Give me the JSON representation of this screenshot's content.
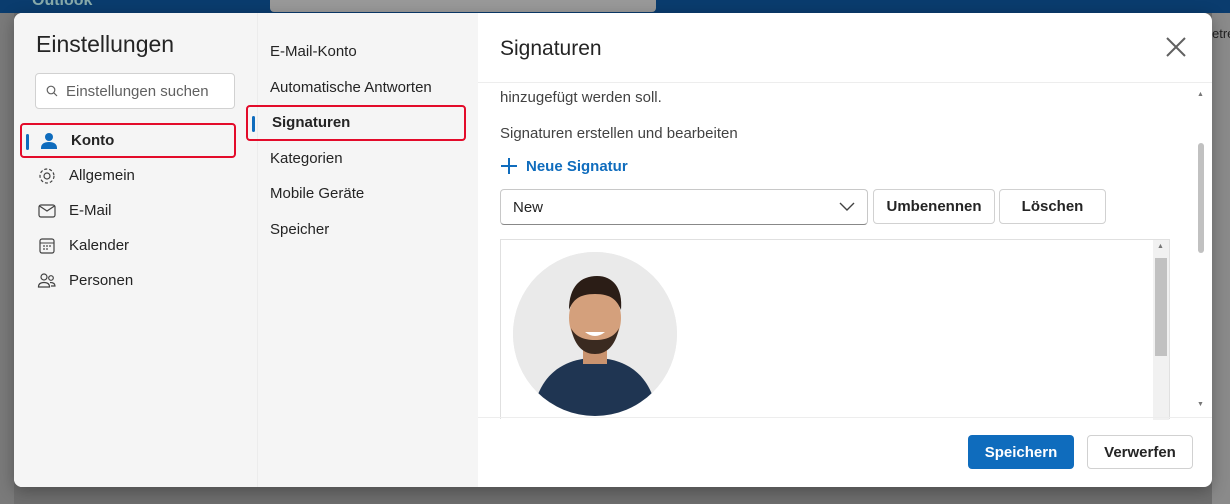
{
  "background": {
    "app_name": "Outlook",
    "right_text": "etre"
  },
  "settings": {
    "title": "Einstellungen",
    "search_placeholder": "Einstellungen suchen",
    "nav": [
      {
        "label": "Konto",
        "icon": "person-icon",
        "active": true
      },
      {
        "label": "Allgemein",
        "icon": "gear-icon"
      },
      {
        "label": "E-Mail",
        "icon": "mail-icon"
      },
      {
        "label": "Kalender",
        "icon": "calendar-icon"
      },
      {
        "label": "Personen",
        "icon": "people-icon"
      }
    ],
    "subnav": [
      {
        "label": "E-Mail-Konto"
      },
      {
        "label": "Automatische Antworten"
      },
      {
        "label": "Signaturen",
        "active": true
      },
      {
        "label": "Kategorien"
      },
      {
        "label": "Mobile Geräte"
      },
      {
        "label": "Speicher"
      }
    ]
  },
  "main": {
    "title": "Signaturen",
    "intro_tail": "hinzugefügt werden soll.",
    "section_label": "Signaturen erstellen und bearbeiten",
    "new_signature": "Neue Signatur",
    "selected_signature": "New",
    "rename": "Umbenennen",
    "delete": "Löschen",
    "save": "Speichern",
    "discard": "Verwerfen"
  },
  "colors": {
    "accent": "#0f6cbd",
    "highlight": "#e30b2a"
  }
}
